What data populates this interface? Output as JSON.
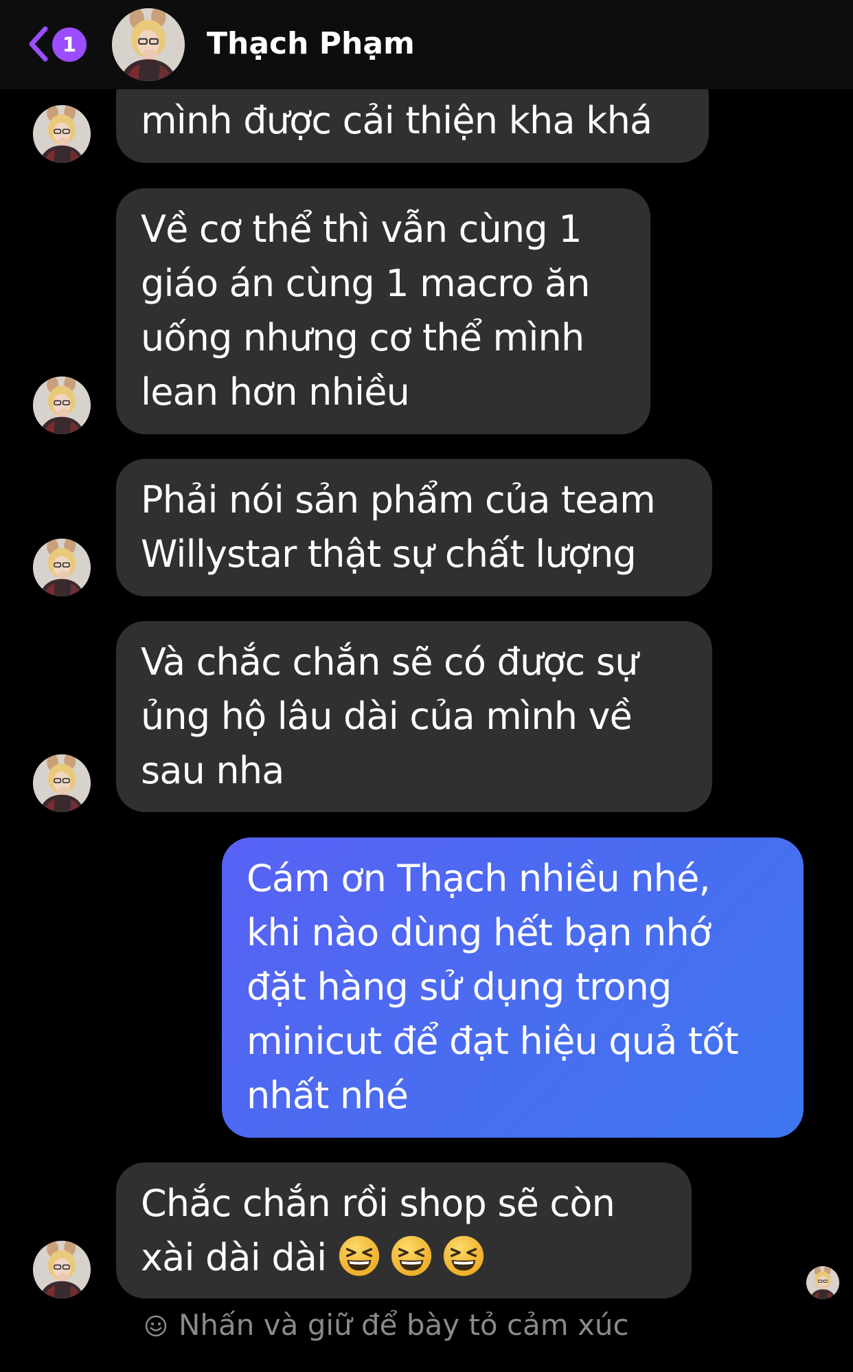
{
  "header": {
    "back_badge_count": "1",
    "contact_name": "Thạch Phạm"
  },
  "messages": [
    {
      "sender": "Thạch Phạm",
      "direction": "incoming",
      "lines": [
        "mình được cải thiện kha khá"
      ]
    },
    {
      "sender": "Thạch Phạm",
      "direction": "incoming",
      "lines": [
        "Về cơ thể thì vẫn cùng 1",
        "giáo án cùng 1 macro ăn",
        "uống nhưng cơ thể mình",
        "lean hơn nhiều"
      ]
    },
    {
      "sender": "Thạch Phạm",
      "direction": "incoming",
      "lines": [
        "Phải nói sản phẩm của team",
        "Willystar thật sự chất lượng"
      ]
    },
    {
      "sender": "Thạch Phạm",
      "direction": "incoming",
      "lines": [
        "Và chắc chắn sẽ có được sự",
        "ủng hộ lâu dài của mình về",
        "sau nha"
      ]
    },
    {
      "sender": "me",
      "direction": "outgoing",
      "lines": [
        "Cám ơn Thạch nhiều nhé,",
        "khi nào dùng hết bạn nhớ",
        "đặt hàng sử dụng trong",
        "minicut để đạt hiệu quả tốt",
        "nhất nhé"
      ]
    },
    {
      "sender": "Thạch Phạm",
      "direction": "incoming",
      "lines": [
        "Chắc chắn rồi shop sẽ còn",
        "xài dài dài"
      ],
      "emojis": [
        "grinning-squinting-face",
        "grinning-squinting-face",
        "grinning-squinting-face"
      ]
    }
  ],
  "reaction_hint": "Nhấn và giữ để bày tỏ cảm xúc",
  "colors": {
    "background": "#000000",
    "incoming_bubble": "#303030",
    "outgoing_bubble_start": "#5862f5",
    "outgoing_bubble_end": "#3f76f0",
    "back_accent": "#9b4dff",
    "hint_text": "#8a8a8e"
  },
  "icons": {
    "back": "chevron-left-icon",
    "reaction": "smile-icon",
    "emoji": "grinning-squinting-face"
  }
}
